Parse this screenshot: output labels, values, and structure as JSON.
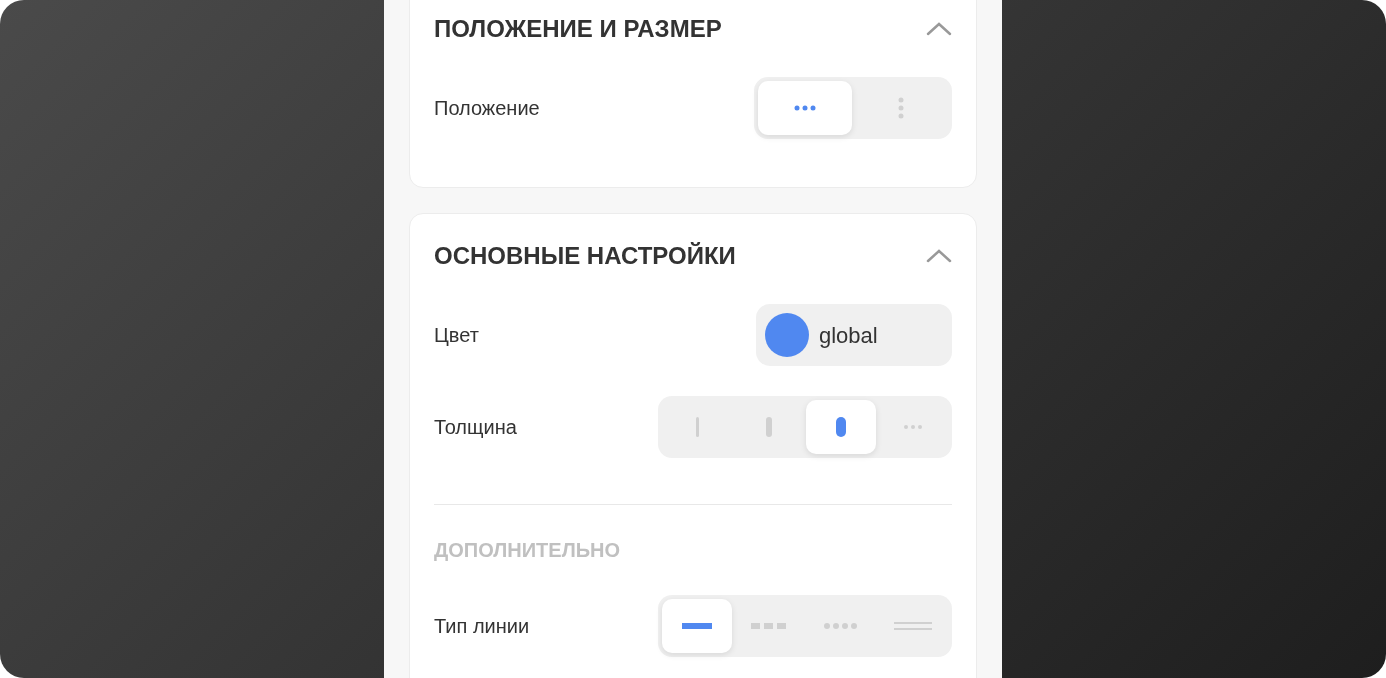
{
  "sections": [
    {
      "title": "ПОЛОЖЕНИЕ И РАЗМЕР",
      "expanded": true,
      "rows": [
        {
          "kind": "segments",
          "label": "Положение",
          "options": [
            {
              "kind": "dots-horizontal",
              "selected": true
            },
            {
              "kind": "dots-vertical",
              "selected": false
            }
          ]
        }
      ]
    },
    {
      "title": "ОСНОВНЫЕ НАСТРОЙКИ",
      "expanded": true,
      "rows": [
        {
          "kind": "color",
          "label": "Цвет",
          "color": "#5088f0",
          "value": "global"
        },
        {
          "kind": "segments",
          "label": "Толщина",
          "options": [
            {
              "kind": "thin",
              "selected": false
            },
            {
              "kind": "medium",
              "selected": false
            },
            {
              "kind": "thick",
              "selected": true
            },
            {
              "kind": "more",
              "selected": false
            }
          ]
        },
        {
          "kind": "divider"
        },
        {
          "kind": "subheading",
          "label": "ДОПОЛНИТЕЛЬНО"
        },
        {
          "kind": "segments",
          "label": "Тип линии",
          "options": [
            {
              "kind": "solid",
              "selected": true
            },
            {
              "kind": "dashed",
              "selected": false
            },
            {
              "kind": "dotted",
              "selected": false
            },
            {
              "kind": "double",
              "selected": false
            }
          ]
        }
      ]
    }
  ]
}
